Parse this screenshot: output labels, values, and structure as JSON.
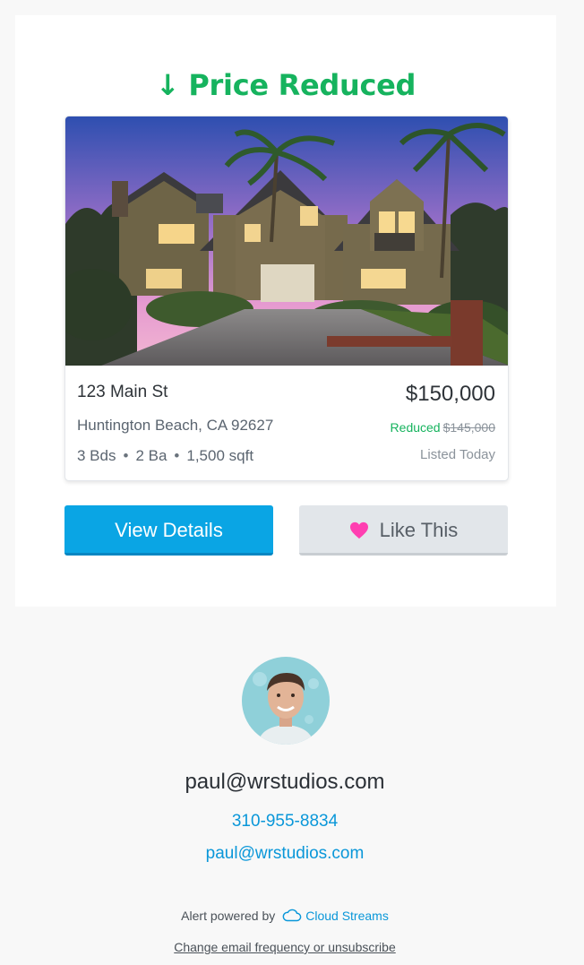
{
  "alert": {
    "arrow": "↓",
    "headline": "Price Reduced",
    "accent_color": "#16b35e"
  },
  "listing": {
    "photo_icon": "house-photo",
    "address": "123 Main St",
    "city": "Huntington Beach, CA 92627",
    "beds": "3 Bds",
    "baths": "2 Ba",
    "sqft": "1,500 sqft",
    "separator": "•",
    "price": "$150,000",
    "reduced_label": "Reduced",
    "old_price": "$145,000",
    "listed": "Listed Today"
  },
  "actions": {
    "view_label": "View Details",
    "like_label": "Like This",
    "view_color": "#0aa5e4",
    "heart_color": "#ff3fb1"
  },
  "agent": {
    "name": "paul@wrstudios.com",
    "phone": "310-955-8834",
    "email": "paul@wrstudios.com",
    "link_color": "#0a97d9"
  },
  "footer": {
    "powered_by": "Alert powered by",
    "brand": "Cloud Streams",
    "brand_icon": "cloud-icon",
    "unsubscribe": "Change email frequency or unsubscribe"
  }
}
